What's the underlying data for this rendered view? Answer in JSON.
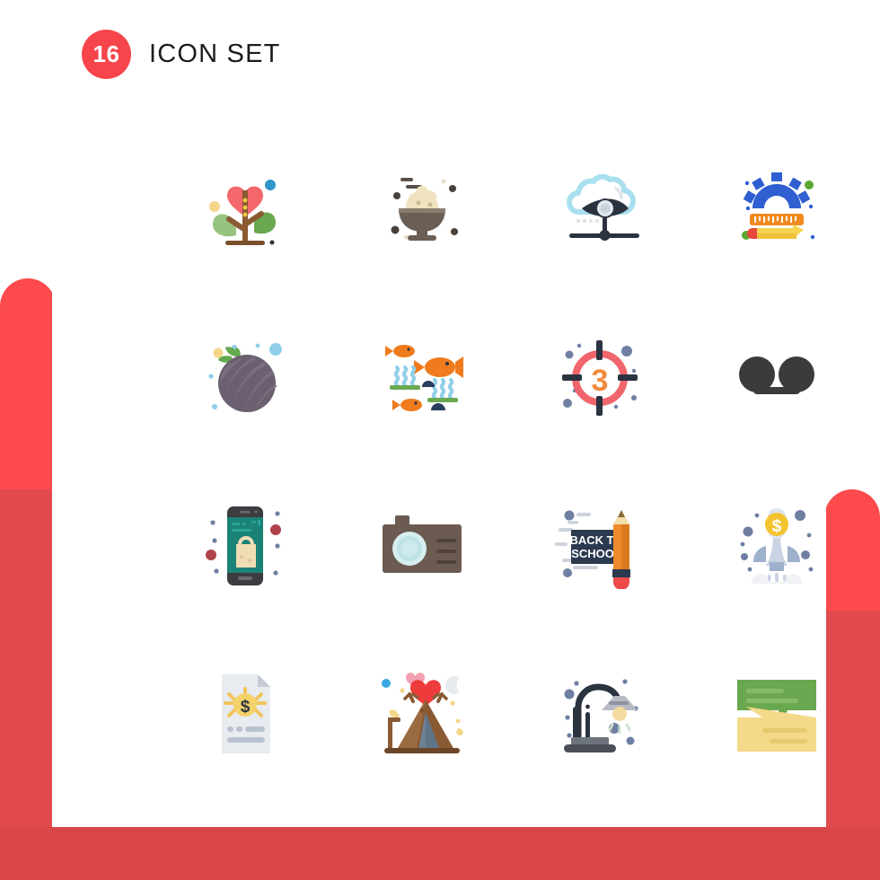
{
  "header": {
    "badge_count": "16",
    "title": "Icon Set",
    "badge_color": "#f6454b",
    "title_color": "#1c1c1c"
  },
  "background": {
    "accent_red": "#fc4a4d",
    "accent_red_dark": "#e14b4e",
    "bottom_band": "#d8464a",
    "card": "#ffffff"
  },
  "grid": {
    "columns": 4,
    "rows": 4,
    "count": 16
  },
  "icons": [
    {
      "index": "1",
      "name": "heart-flower-icon",
      "label": "Heart Flower"
    },
    {
      "index": "2",
      "name": "food-bowl-icon",
      "label": "Food Bowl"
    },
    {
      "index": "3",
      "name": "cloud-monitoring-icon",
      "label": "Cloud Monitoring"
    },
    {
      "index": "4",
      "name": "design-tools-icon",
      "label": "Design Tools"
    },
    {
      "index": "5",
      "name": "melon-fruit-icon",
      "label": "Melon Fruit"
    },
    {
      "index": "6",
      "name": "aquarium-icon",
      "label": "Aquarium"
    },
    {
      "index": "7",
      "name": "countdown-target-icon",
      "label": "Countdown 3"
    },
    {
      "index": "8",
      "name": "glasses-icon",
      "label": "Glasses"
    },
    {
      "index": "9",
      "name": "mobile-shopping-icon",
      "label": "Mobile Shopping"
    },
    {
      "index": "10",
      "name": "camera-icon",
      "label": "Camera"
    },
    {
      "index": "11",
      "name": "back-to-school-icon",
      "label": "Back To School"
    },
    {
      "index": "12",
      "name": "startup-rocket-icon",
      "label": "Startup Rocket"
    },
    {
      "index": "13",
      "name": "invoice-document-icon",
      "label": "Invoice Document"
    },
    {
      "index": "14",
      "name": "romantic-tent-icon",
      "label": "Romantic Tent"
    },
    {
      "index": "15",
      "name": "desk-lamp-icon",
      "label": "Desk Lamp"
    },
    {
      "index": "16",
      "name": "chat-bubbles-icon",
      "label": "Chat Bubbles"
    }
  ],
  "icon_text": {
    "countdown_number": "3",
    "chalkboard_line1": "BACK TO",
    "chalkboard_line2": "SCHOOL",
    "coin_symbol": "$",
    "rocket_symbol": "$"
  }
}
